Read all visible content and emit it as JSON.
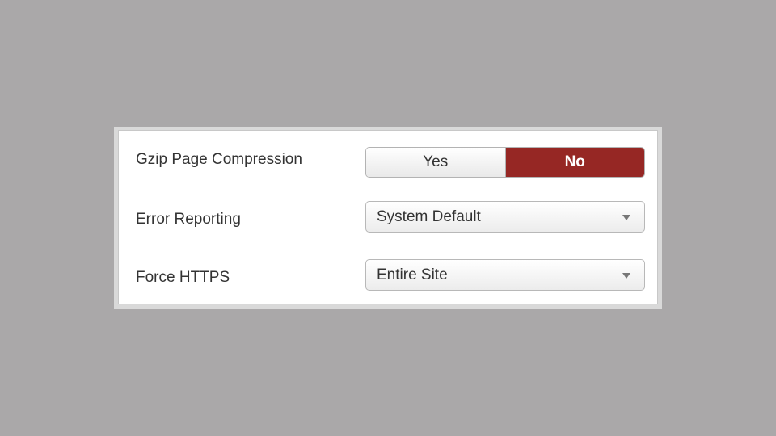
{
  "settings": {
    "gzip": {
      "label": "Gzip Page Compression",
      "yes_label": "Yes",
      "no_label": "No",
      "selected": "No"
    },
    "error_reporting": {
      "label": "Error Reporting",
      "value": "System Default"
    },
    "force_https": {
      "label": "Force HTTPS",
      "value": "Entire Site"
    }
  },
  "colors": {
    "background": "#aaa8a9",
    "toggle_active": "#962724",
    "panel": "#ffffff"
  },
  "icons": {
    "dropdown": "caret-down-icon"
  }
}
